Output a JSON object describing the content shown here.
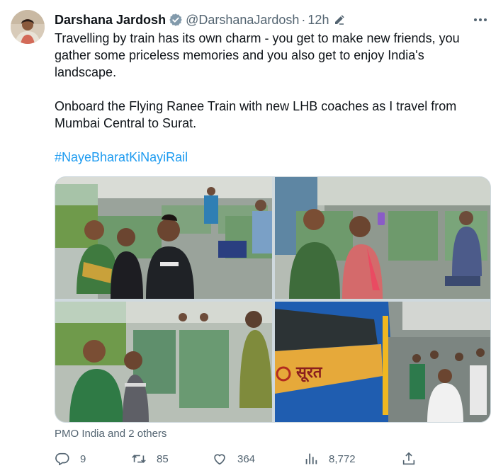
{
  "author": {
    "name": "Darshana Jardosh",
    "handle": "@DarshanaJardosh",
    "separator": "·",
    "time": "12h",
    "verified": true
  },
  "tweet": {
    "paragraph1": "Travelling by train has its own charm - you get to make new friends, you gather some priceless memories and you also get to enjoy India's landscape.",
    "paragraph2": "Onboard the Flying Ranee Train with new LHB coaches as I travel from Mumbai Central to Surat.",
    "hashtag": "#NayeBharatKiNayiRail"
  },
  "media": {
    "photos": [
      {
        "description_id": "photo-1"
      },
      {
        "description_id": "photo-2"
      },
      {
        "description_id": "photo-3"
      },
      {
        "description_id": "photo-4",
        "sign_text": "सूरत"
      }
    ]
  },
  "tagged": "PMO India and 2 others",
  "actions": {
    "replies": "9",
    "retweets": "85",
    "likes": "364",
    "views": "8,772"
  },
  "colors": {
    "accent": "#1d9bf0",
    "text": "#0f1419",
    "secondary": "#536471",
    "border": "#cfd9de"
  }
}
